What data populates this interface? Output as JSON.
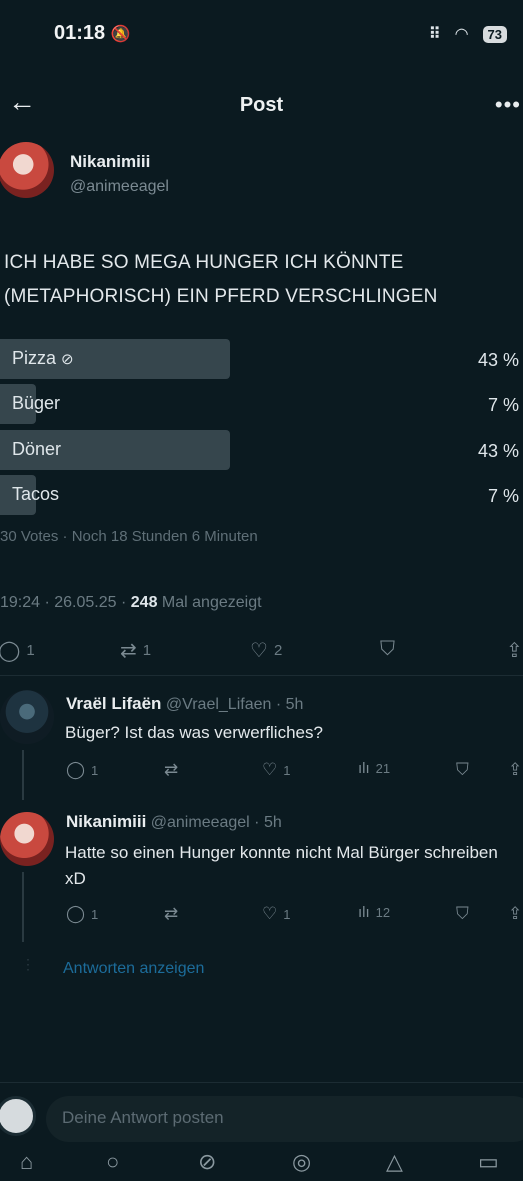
{
  "status_bar": {
    "time": "01:18",
    "battery": "73"
  },
  "header": {
    "title": "Post"
  },
  "post": {
    "author_name": "Nikanimiii",
    "author_handle": "@animeeagel",
    "text": "ICH HABE SO MEGA HUNGER ICH KÖNNTE (METAPHORISCH) EIN PFERD VERSCHLINGEN",
    "poll": {
      "options": [
        {
          "label": "Pizza",
          "percent_label": "43 %",
          "percent": 43,
          "selected": true
        },
        {
          "label": "Büger",
          "percent_label": "7 %",
          "percent": 7,
          "selected": false
        },
        {
          "label": "Döner",
          "percent_label": "43 %",
          "percent": 43,
          "selected": false
        },
        {
          "label": "Tacos",
          "percent_label": "7 %",
          "percent": 7,
          "selected": false
        }
      ],
      "meta": "30 Votes · Noch 18 Stunden 6 Minuten"
    },
    "time_date": "19:24 · 26.05.25 · ",
    "views_count": "248",
    "views_label": " Mal angezeigt",
    "actions": {
      "replies": "1",
      "reposts": "1",
      "likes": "2"
    }
  },
  "replies": [
    {
      "author_name": "Vraël Lifaën",
      "author_handle": "@Vrael_Lifaen · 5h",
      "text": "Büger? Ist das was verwerfliches?",
      "replies": "1",
      "likes": "1",
      "views": "21"
    },
    {
      "author_name": "Nikanimiii",
      "author_handle": "@animeeagel · 5h",
      "text": "Hatte so einen Hunger konnte nicht Mal Bürger schreiben xD",
      "replies": "1",
      "likes": "1",
      "views": "12"
    }
  ],
  "show_replies": "Antworten anzeigen",
  "composer": {
    "placeholder": "Deine Antwort posten"
  },
  "colors": {
    "background": "#0b1a20",
    "poll_bar": "#36464d",
    "link": "#1c6c9a"
  },
  "icons": [
    "back-arrow-icon",
    "more-icon",
    "check-circle-icon",
    "reply-icon",
    "repost-icon",
    "heart-icon",
    "bookmark-icon",
    "share-icon",
    "views-icon"
  ]
}
